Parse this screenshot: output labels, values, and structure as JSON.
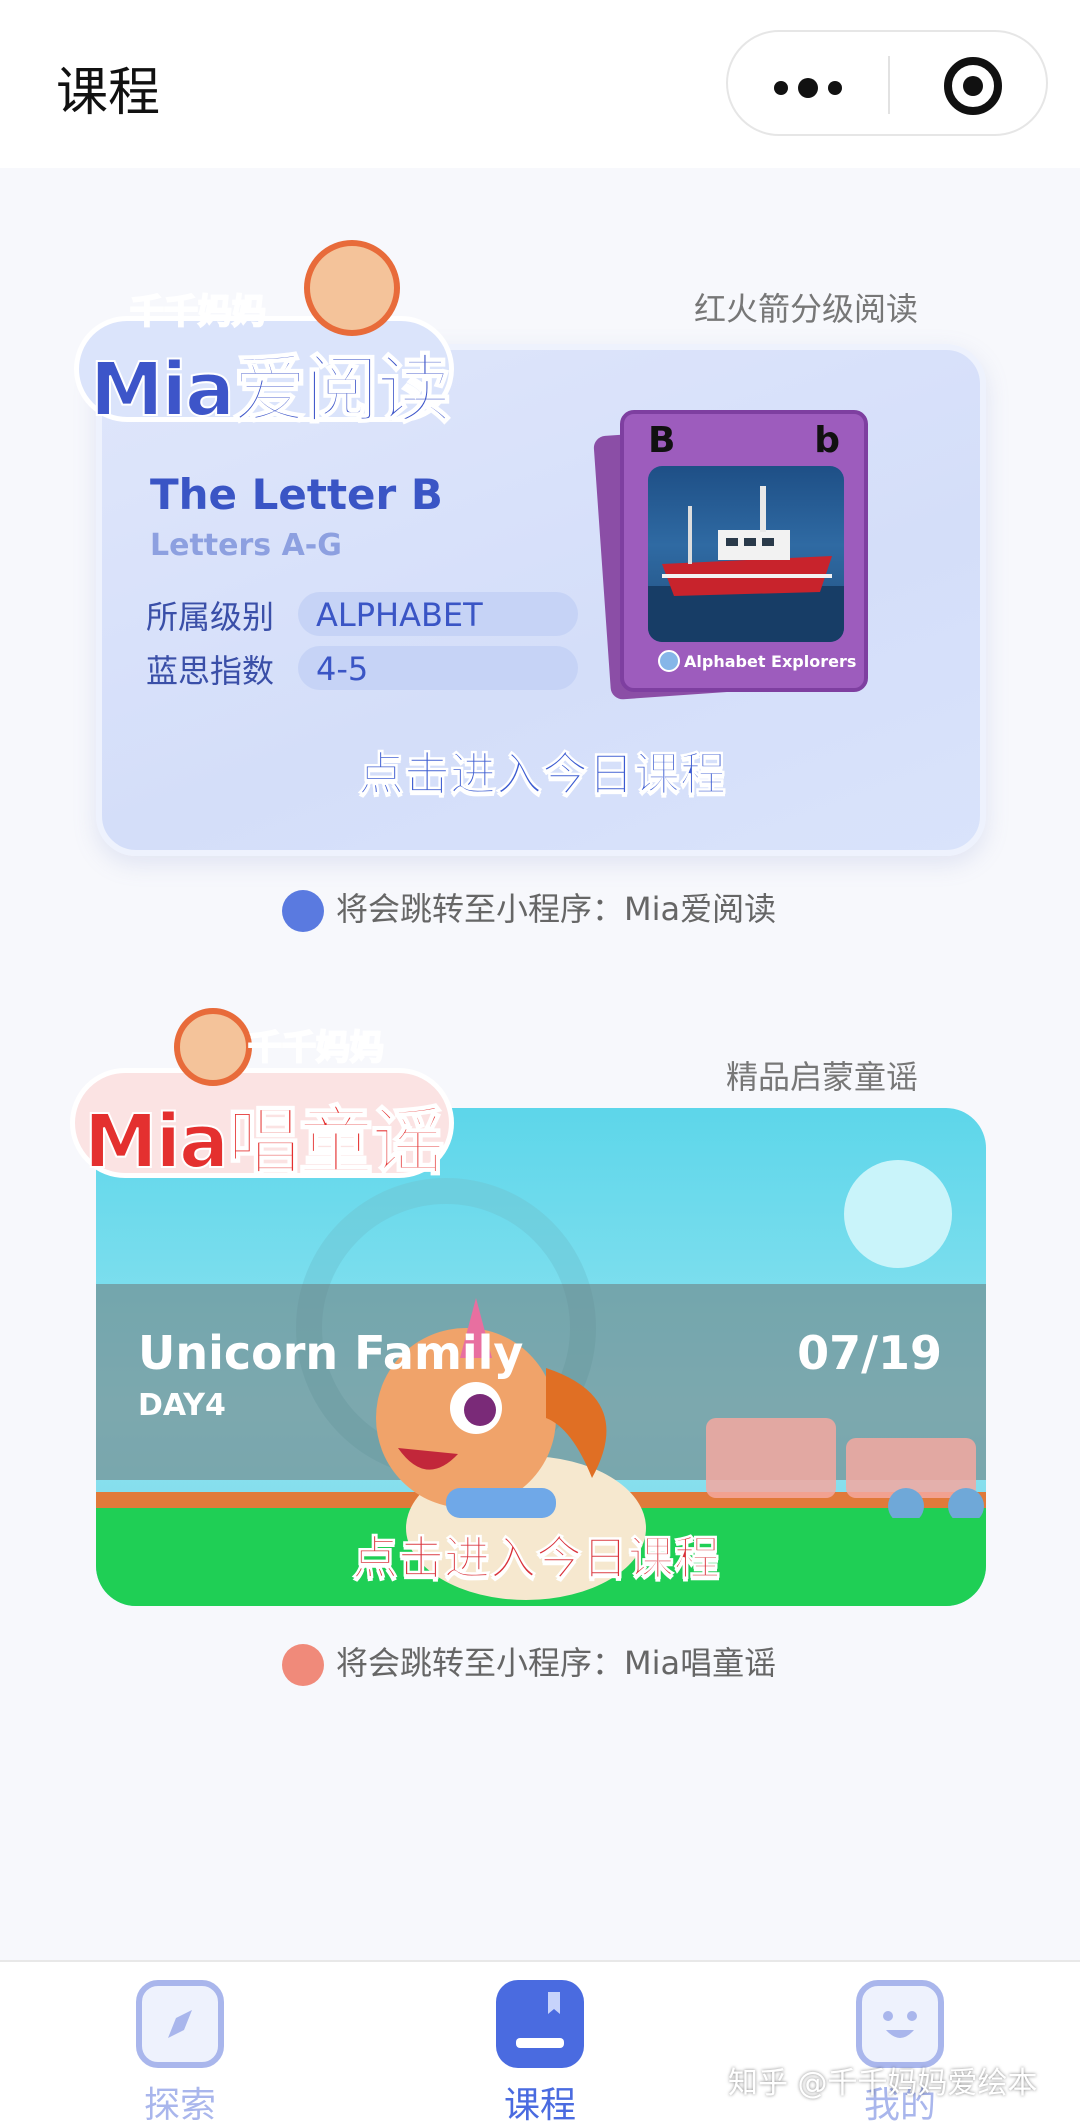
{
  "header": {
    "title": "课程",
    "more_icon": "more-dots-icon",
    "close_icon": "target-icon"
  },
  "reading_section": {
    "tag": "红火箭分级阅读",
    "logo_sub": "千千妈妈",
    "logo_main": "Mia爱阅读",
    "book_title": "The Letter B",
    "book_subtitle": "Letters A-G",
    "level_label": "所属级别",
    "level_value": "ALPHABET",
    "lexile_label": "蓝思指数",
    "lexile_value": "4-5",
    "card_upper": "B",
    "card_lower": "b",
    "card_caption": "Alphabet Explorers",
    "cta": "点击进入今日课程",
    "redirect": "将会跳转至小程序：Mia爱阅读"
  },
  "songs_section": {
    "tag": "精品启蒙童谣",
    "logo_sub": "千千妈妈",
    "logo_main": "Mia唱童谣",
    "song_title": "Unicorn Family",
    "song_day": "DAY4",
    "song_date": "07/19",
    "cta": "点击进入今日课程",
    "redirect": "将会跳转至小程序：Mia唱童谣"
  },
  "tabbar": {
    "items": [
      {
        "label": "探索",
        "icon": "compass-icon",
        "active": false
      },
      {
        "label": "课程",
        "icon": "book-icon",
        "active": true
      },
      {
        "label": "我的",
        "icon": "smile-face-icon",
        "active": false
      }
    ]
  },
  "watermark": "知乎 @千千妈妈爱绘本",
  "colors": {
    "accent_blue": "#3b5bd1",
    "accent_red": "#e9352f",
    "tab_active": "#4a6be0",
    "tab_inactive": "#a9b6ec"
  }
}
